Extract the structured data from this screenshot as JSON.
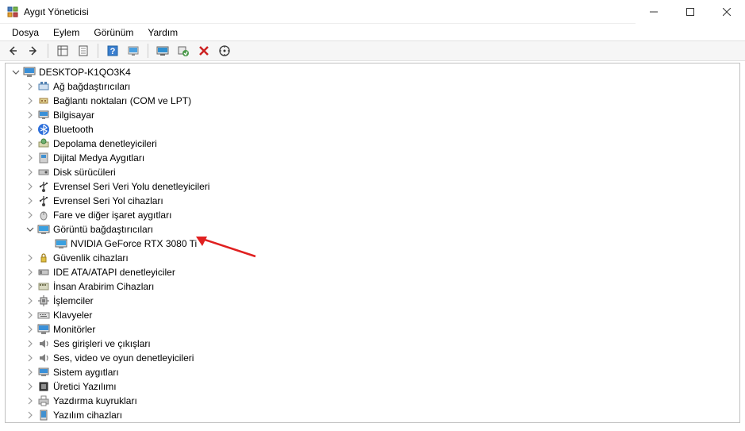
{
  "window": {
    "title": "Aygıt Yöneticisi"
  },
  "menu": {
    "file": "Dosya",
    "action": "Eylem",
    "view": "Görünüm",
    "help": "Yardım"
  },
  "toolbar_icons": {
    "back": "back-icon",
    "forward": "forward-icon",
    "show_hidden": "show-hidden-icon",
    "properties": "properties-icon",
    "help": "help-icon",
    "update": "update-icon",
    "monitor": "monitor-icon",
    "uninstall": "uninstall-icon",
    "delete": "delete-icon",
    "scan": "scan-icon"
  },
  "tree": {
    "root": "DESKTOP-K1QO3K4",
    "items": [
      {
        "label": "Ağ bağdaştırıcıları"
      },
      {
        "label": "Bağlantı noktaları (COM ve LPT)"
      },
      {
        "label": "Bilgisayar"
      },
      {
        "label": "Bluetooth"
      },
      {
        "label": "Depolama denetleyicileri"
      },
      {
        "label": "Dijital Medya Aygıtları"
      },
      {
        "label": "Disk sürücüleri"
      },
      {
        "label": "Evrensel Seri Veri Yolu denetleyicileri"
      },
      {
        "label": "Evrensel Seri Yol cihazları"
      },
      {
        "label": "Fare ve diğer işaret aygıtları"
      },
      {
        "label": "Görüntü bağdaştırıcıları",
        "expanded": true,
        "children": [
          {
            "label": "NVIDIA GeForce RTX 3080 Ti"
          }
        ]
      },
      {
        "label": "Güvenlik cihazları"
      },
      {
        "label": "IDE ATA/ATAPI denetleyiciler"
      },
      {
        "label": "İnsan Arabirim Cihazları"
      },
      {
        "label": "İşlemciler"
      },
      {
        "label": "Klavyeler"
      },
      {
        "label": "Monitörler"
      },
      {
        "label": "Ses girişleri ve çıkışları"
      },
      {
        "label": "Ses, video ve oyun denetleyicileri"
      },
      {
        "label": "Sistem aygıtları"
      },
      {
        "label": "Üretici Yazılımı"
      },
      {
        "label": "Yazdırma kuyrukları"
      },
      {
        "label": "Yazılım cihazları"
      }
    ]
  }
}
